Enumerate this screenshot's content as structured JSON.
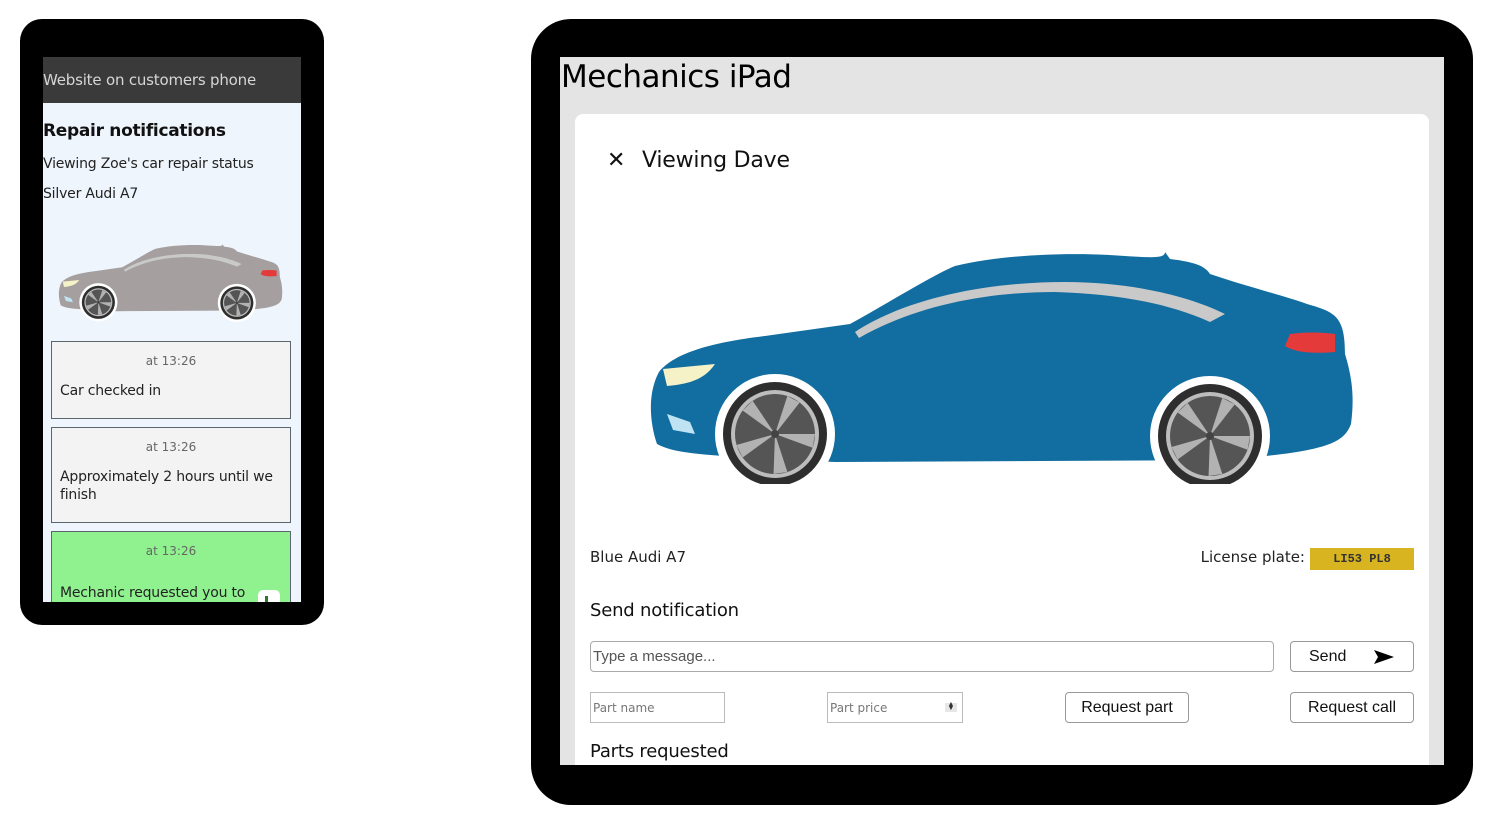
{
  "phone": {
    "header": "Website on customers phone",
    "title": "Repair notifications",
    "subtitle": "Viewing Zoe's car repair status",
    "car_name": "Silver Audi A7",
    "car_color": "#a5a09f",
    "notifications": [
      {
        "time": "at 13:26",
        "message": "Car checked in",
        "highlight": false
      },
      {
        "time": "at 13:26",
        "message": "Approximately 2 hours until we finish",
        "highlight": false
      },
      {
        "time": "at 13:26",
        "message": "Mechanic requested you to",
        "highlight": true
      }
    ]
  },
  "ipad": {
    "title": "Mechanics iPad",
    "close_icon": "close-icon",
    "viewing_label": "Viewing Dave",
    "car_name": "Blue Audi A7",
    "car_color": "#126ea0",
    "license_plate_label": "License plate:",
    "license_plate": "LI53 PL8",
    "send_notification_heading": "Send notification",
    "message_placeholder": "Type a message...",
    "send_label": "Send",
    "send_icon": "send-arrow-icon",
    "part_name_placeholder": "Part name",
    "part_price_placeholder": "Part price",
    "request_part_label": "Request part",
    "request_call_label": "Request call",
    "parts_requested_heading": "Parts requested"
  },
  "colors": {
    "plate_yellow": "#d8b421",
    "highlight_green": "#8ff28f",
    "phone_bg": "#eef5fd",
    "ipad_bg": "#e4e4e4"
  }
}
